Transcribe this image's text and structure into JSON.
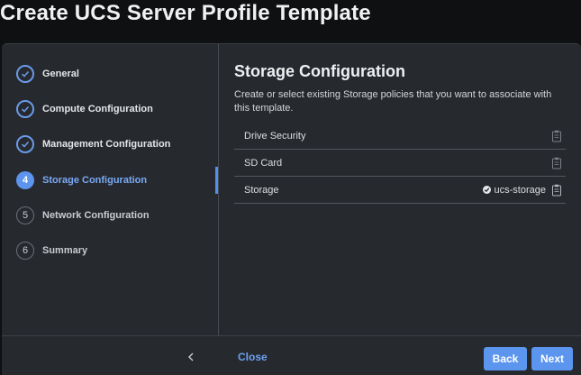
{
  "page": {
    "title": "Create UCS Server Profile Template"
  },
  "steps": [
    {
      "label": "General",
      "state": "done",
      "number": "1"
    },
    {
      "label": "Compute Configuration",
      "state": "done",
      "number": "2"
    },
    {
      "label": "Management Configuration",
      "state": "done",
      "number": "3"
    },
    {
      "label": "Storage Configuration",
      "state": "current",
      "number": "4"
    },
    {
      "label": "Network Configuration",
      "state": "todo",
      "number": "5"
    },
    {
      "label": "Summary",
      "state": "todo",
      "number": "6"
    }
  ],
  "section": {
    "title": "Storage Configuration",
    "description": "Create or select existing Storage policies that you want to associate with this template."
  },
  "policies": [
    {
      "label": "Drive Security",
      "value": ""
    },
    {
      "label": "SD Card",
      "value": ""
    },
    {
      "label": "Storage",
      "value": "ucs-storage"
    }
  ],
  "footer": {
    "close_label": "Close",
    "back_label": "Back",
    "next_label": "Next"
  },
  "colors": {
    "accent": "#5b95ee",
    "panel": "#26292e",
    "background": "#0f1012"
  },
  "icons": {
    "done": "check-circle-icon",
    "collapse": "chevron-left-icon",
    "policy_action": "clipboard-icon",
    "selected": "check-icon"
  }
}
